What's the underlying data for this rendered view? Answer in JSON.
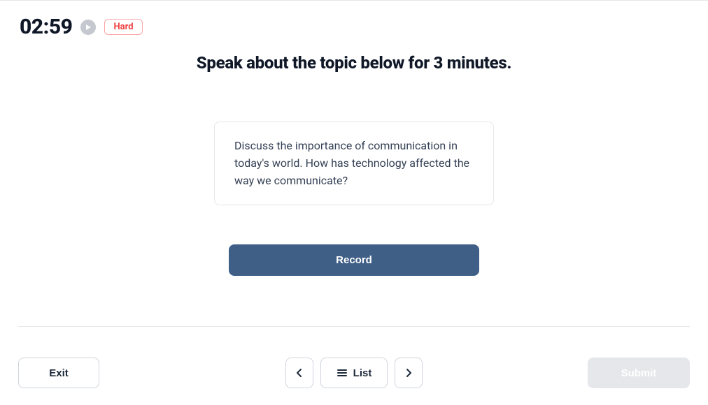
{
  "header": {
    "timer": "02:59",
    "difficulty": "Hard"
  },
  "instruction": "Speak about the topic below for 3 minutes.",
  "prompt": "Discuss the importance of communication in today's world. How has technology affected the way we communicate?",
  "actions": {
    "record": "Record"
  },
  "footer": {
    "exit": "Exit",
    "list": "List",
    "submit": "Submit"
  }
}
